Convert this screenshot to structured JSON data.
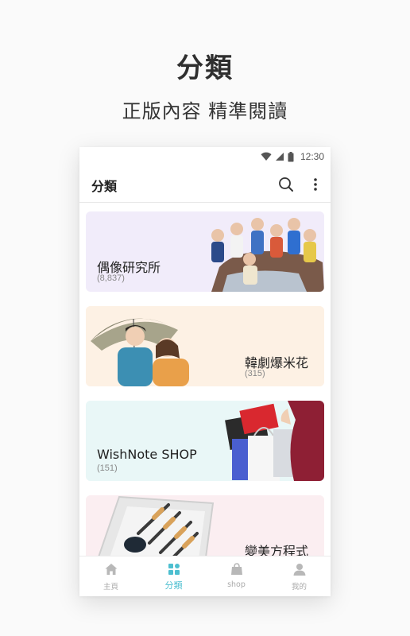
{
  "hero": {
    "title": "分類",
    "subtitle": "正版內容  精準閱讀"
  },
  "status_bar": {
    "time": "12:30",
    "icons": [
      "wifi-icon",
      "signal-icon",
      "battery-icon"
    ]
  },
  "app_bar": {
    "title": "分類",
    "actions": [
      "search-icon",
      "more-vert-icon"
    ]
  },
  "categories": [
    {
      "name": "偶像研究所",
      "count": "(8,837)",
      "bg": "#f1ecfa"
    },
    {
      "name": "韓劇爆米花",
      "count": "(315)",
      "bg": "#fdf1e4"
    },
    {
      "name": "WishNote SHOP",
      "count": "(151)",
      "bg": "#e9f7f7"
    },
    {
      "name": "變美方程式",
      "count": "",
      "bg": "#fbeef1"
    }
  ],
  "tabs": [
    {
      "label": "主頁",
      "icon": "home-icon",
      "active": false
    },
    {
      "label": "分類",
      "icon": "category-grid-icon",
      "active": true
    },
    {
      "label": "shop",
      "icon": "shopping-bag-icon",
      "active": false
    },
    {
      "label": "我的",
      "icon": "person-icon",
      "active": false
    }
  ],
  "colors": {
    "accent": "#4dbfd0",
    "inactive_tab": "#b8b8b8",
    "page_bg": "#fafafa"
  }
}
